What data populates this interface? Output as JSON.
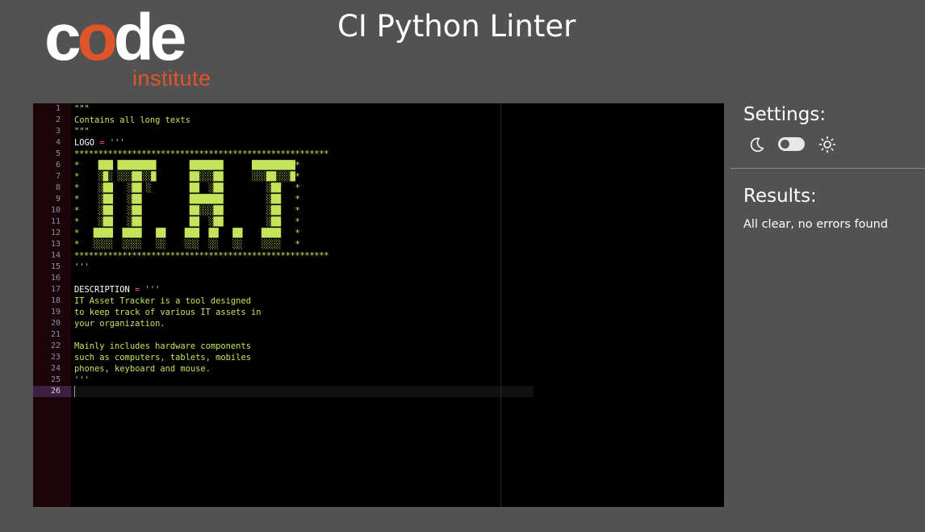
{
  "logo": {
    "word_c": "c",
    "word_o": "o",
    "word_de": "de",
    "tagline": "institute"
  },
  "title": "CI Python Linter",
  "editor": {
    "line_numbers": [
      "1",
      "2",
      "3",
      "4",
      "5",
      "6",
      "7",
      "8",
      "9",
      "10",
      "11",
      "12",
      "13",
      "14",
      "15",
      "16",
      "17",
      "18",
      "19",
      "20",
      "21",
      "22",
      "23",
      "24",
      "25",
      "26"
    ],
    "active_line": "26",
    "lines": {
      "l1": "\"\"\"",
      "l2": "Contains all long texts",
      "l3": "\"\"\"",
      "l4_var": "LOGO",
      "l4_op": "=",
      "l4_str": "'''",
      "l5": "*****************************************************",
      "l6": "*    ███ ████████       ███████      █████████*",
      "l7": "*    ░█░ ░░░██░░█       ██░░░██      ░░░██░░░█*",
      "l8": "*    ░██   ░██ ░        ██  ░██         ░██   *",
      "l9": "*    ░██   ░██          ███████         ░██   *",
      "l10": "*    ░██   ░██          ██░░░██         ░██   *",
      "l11": "*    ░██   ░██          ██  ░██         ░██   *",
      "l12": "*   ████  ████   ██    ███  ██   ██    ████   *",
      "l13": "*   ░░░░  ░░░░   ░░    ░░░  ░░   ░░    ░░░░   *",
      "l14": "*****************************************************",
      "l15": "'''",
      "l16": "",
      "l17_var": "DESCRIPTION",
      "l17_op": "=",
      "l17_str": "'''",
      "l18": "IT Asset Tracker is a tool designed",
      "l19": "to keep track of various IT assets in",
      "l20": "your organization.",
      "l21": "",
      "l22": "Mainly includes hardware components",
      "l23": "such as computers, tablets, mobiles",
      "l24": "phones, keyboard and mouse.",
      "l25": "'''",
      "l26": ""
    }
  },
  "settings": {
    "title": "Settings:",
    "dark_icon": "moon-icon",
    "light_icon": "sun-icon",
    "theme_toggle_state": "dark"
  },
  "results": {
    "title": "Results:",
    "message": "All clear, no errors found"
  },
  "colors": {
    "background": "#525252",
    "editor_bg": "#000000",
    "gutter_bg": "#1b0408",
    "string": "#c5e45c",
    "operator": "#f24aa3",
    "brand_orange": "#e0542a"
  }
}
